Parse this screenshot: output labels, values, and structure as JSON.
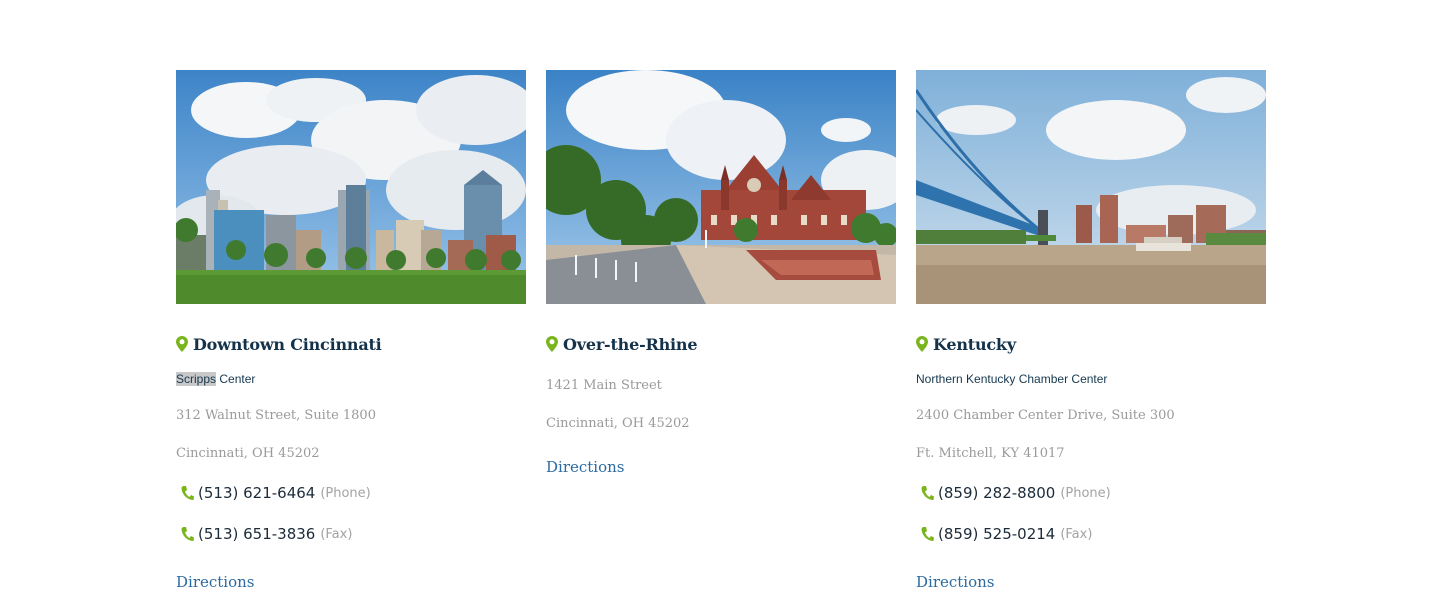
{
  "colors": {
    "accent_green": "#7ab51d",
    "title_navy": "#14324a",
    "link_blue": "#2a6aa0",
    "muted_gray": "#9a9a9a"
  },
  "locations": [
    {
      "title": "Downtown Cincinnati",
      "venue_highlight": "Scripps",
      "venue_rest": " Center",
      "address_line1": "312 Walnut Street, Suite 1800",
      "address_line2": "Cincinnati, OH 45202",
      "phone": "(513) 621-6464",
      "phone_label": "(Phone)",
      "fax": "(513) 651-3836",
      "fax_label": "(Fax)",
      "directions_label": "Directions",
      "photo": "downtown-skyline-photo"
    },
    {
      "title": "Over-the-Rhine",
      "address_line1": "1421 Main Street",
      "address_line2": "Cincinnati, OH 45202",
      "directions_label": "Directions",
      "photo": "music-hall-fountain-photo"
    },
    {
      "title": "Kentucky",
      "venue": "Northern Kentucky Chamber Center",
      "address_line1": "2400 Chamber Center Drive, Suite 300",
      "address_line2": "Ft. Mitchell, KY 41017",
      "phone": "(859) 282-8800",
      "phone_label": "(Phone)",
      "fax": "(859) 525-0214",
      "fax_label": "(Fax)",
      "directions_label": "Directions",
      "photo": "bridge-river-photo"
    }
  ]
}
